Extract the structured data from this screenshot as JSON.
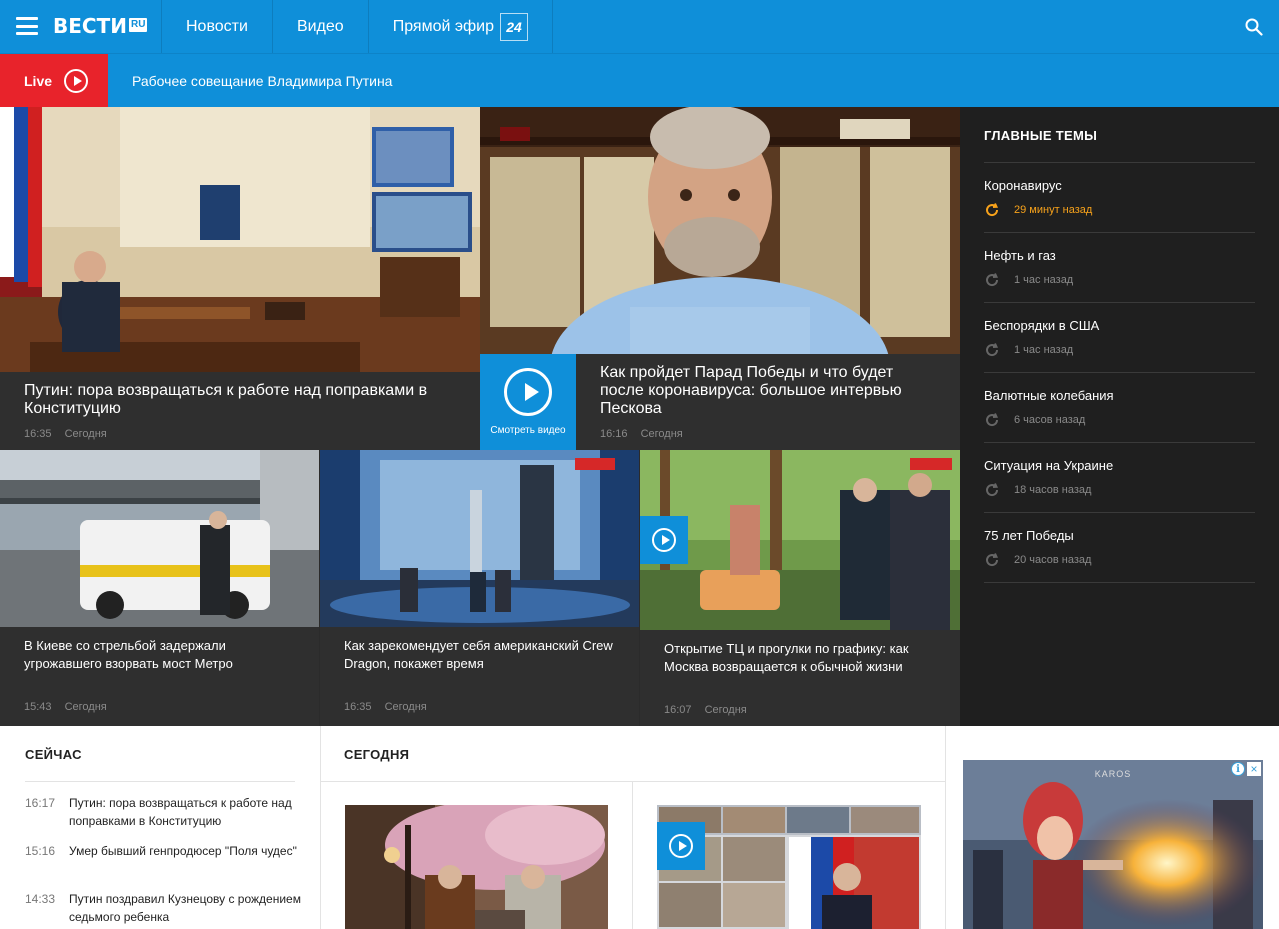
{
  "header": {
    "logo_text": "ВЕСТИ",
    "logo_suffix": "RU",
    "nav": [
      {
        "label": "Новости"
      },
      {
        "label": "Видео"
      },
      {
        "label": "Прямой эфир",
        "badge": "24"
      }
    ]
  },
  "live": {
    "tag": "Live",
    "title": "Рабочее совещание Владимира Путина"
  },
  "featured": [
    {
      "title": "Путин: пора возвращаться к работе над поправками в Конституцию",
      "time": "16:35",
      "day": "Сегодня"
    },
    {
      "title": "Как пройдет Парад Победы и что будет после коронавируса: большое интервью Пескова",
      "time": "16:16",
      "day": "Сегодня",
      "video_label": "Смотреть видео"
    }
  ],
  "grid": [
    {
      "title": "В Киеве со стрельбой задержали угрожавшего взорвать мост Метро",
      "time": "15:43",
      "day": "Сегодня"
    },
    {
      "title": "Как зарекомендует себя американский Crew Dragon, покажет время",
      "time": "16:35",
      "day": "Сегодня"
    },
    {
      "title": "Открытие ТЦ и прогулки по графику: как Москва возвращается к обычной жизни",
      "time": "16:07",
      "day": "Сегодня"
    }
  ],
  "topics": {
    "heading": "ГЛАВНЫЕ ТЕМЫ",
    "items": [
      {
        "name": "Коронавирус",
        "time": "29 минут назад",
        "hot": true
      },
      {
        "name": "Нефть и газ",
        "time": "1 час назад"
      },
      {
        "name": "Беспорядки в США",
        "time": "1 час назад"
      },
      {
        "name": "Валютные колебания",
        "time": "6 часов назад"
      },
      {
        "name": "Ситуация на Украине",
        "time": "18 часов назад"
      },
      {
        "name": "75 лет Победы",
        "time": "20 часов назад"
      }
    ]
  },
  "now": {
    "heading": "СЕЙЧАС",
    "items": [
      {
        "time": "16:17",
        "text": "Путин: пора возвращаться к работе над поправками в Конституцию"
      },
      {
        "time": "15:16",
        "text": "Умер бывший генпродюсер \"Поля чудес\""
      },
      {
        "time": "14:33",
        "text": "Путин поздравил Кузнецову с рождением седьмого ребенка"
      }
    ]
  },
  "today": {
    "heading": "СЕГОДНЯ"
  },
  "ad": {
    "brand": "KAROS",
    "info": "i",
    "close": "×"
  },
  "colors": {
    "brand_blue": "#0f8fd9",
    "live_red": "#e8232b",
    "hot_orange": "#f7a21b"
  }
}
